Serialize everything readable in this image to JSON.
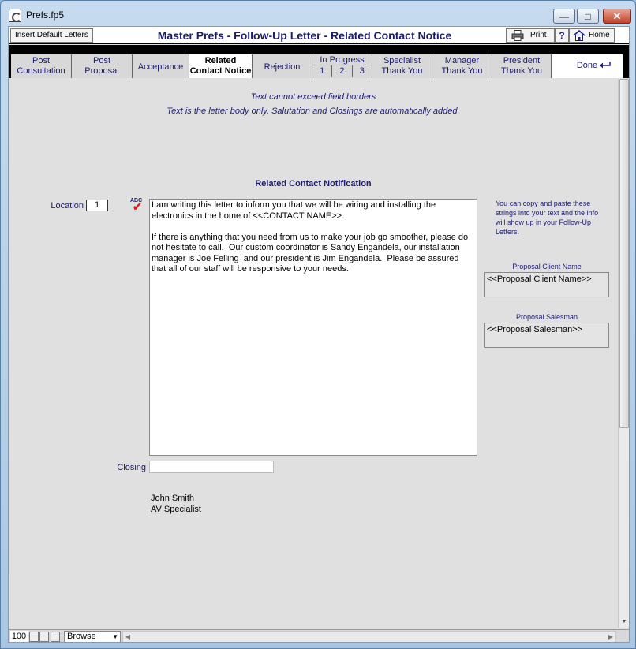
{
  "window": {
    "title": "Prefs.fp5"
  },
  "toolbar": {
    "insert_default_letters": "Insert Default Letters",
    "title": "Master Prefs - Follow-Up Letter - Related Contact Notice",
    "print_label": "Print",
    "help_label": "?",
    "home_label": "Home"
  },
  "tabs": {
    "post_consultation": [
      "Post",
      "Consultation"
    ],
    "post_proposal": [
      "Post",
      "Proposal"
    ],
    "acceptance": "Acceptance",
    "related_contact_notice": [
      "Related",
      "Contact Notice"
    ],
    "rejection": "Rejection",
    "in_progress": {
      "label": "In Progress",
      "steps": [
        "1",
        "2",
        "3"
      ]
    },
    "specialist_thank_you": [
      "Specialist",
      "Thank You"
    ],
    "manager_thank_you": [
      "Manager",
      "Thank You"
    ],
    "president_thank_you": [
      "President",
      "Thank You"
    ],
    "done": "Done"
  },
  "notes": {
    "line1": "Text cannot exceed field borders",
    "line2": "Text is the letter body only.  Salutation and Closings are automatically added."
  },
  "section_title": "Related Contact Notification",
  "location": {
    "label": "Location",
    "value": "1"
  },
  "spellcheck": {
    "badge": "ABC"
  },
  "letter_body": "I am writing this letter to inform you that we will be wiring and installing the electronics in the home of <<CONTACT NAME>>.\n\nIf there is anything that you need from us to make your job go smoother, please do not hesitate to call.  Our custom coordinator is Sandy Engandela, our installation manager is Joe Felling  and our president is Jim Engandela.  Please be assured that all of our staff will be responsive to your needs.",
  "side": {
    "help_text": "You can copy and paste these strings into your text and the info will show up in your Follow-Up Letters.",
    "client_label": "Proposal Client Name",
    "client_value": "<<Proposal Client Name>>",
    "salesman_label": "Proposal Salesman",
    "salesman_value": "<<Proposal Salesman>>"
  },
  "closing": {
    "label": "Closing",
    "value": ""
  },
  "signature": {
    "name": "John Smith",
    "title": "AV Specialist"
  },
  "status": {
    "zoom": "100",
    "mode": "Browse"
  }
}
